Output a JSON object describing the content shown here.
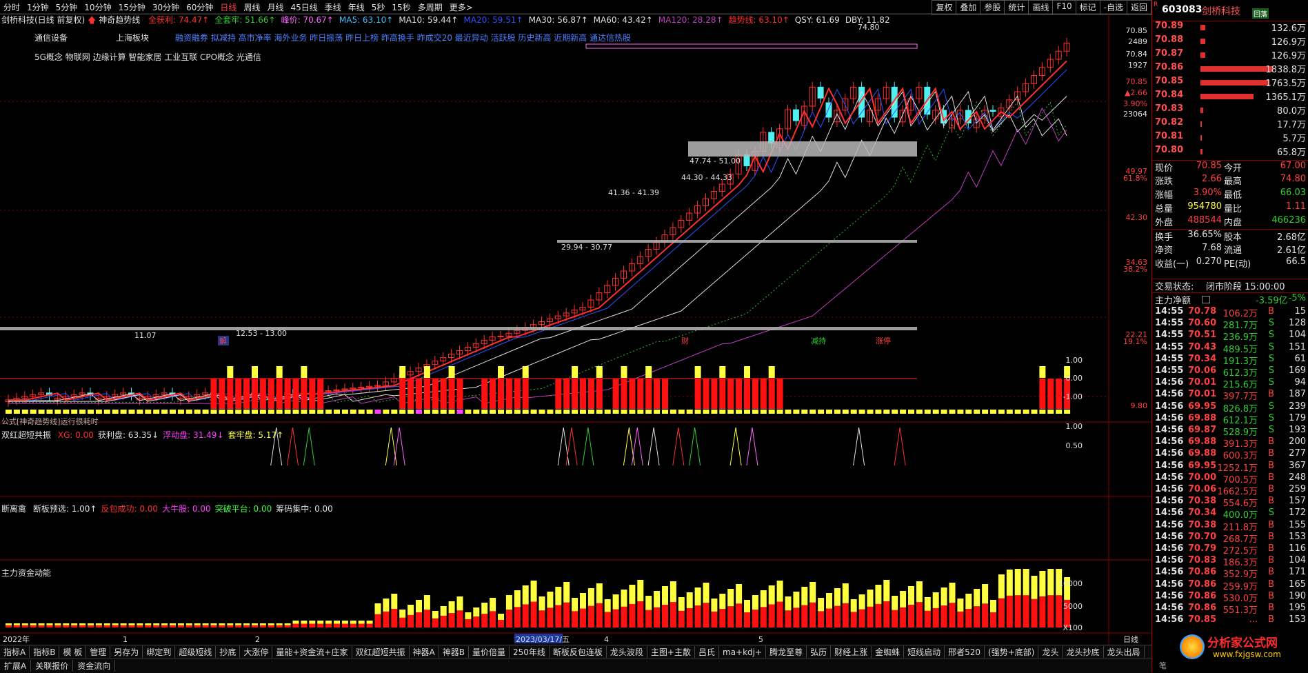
{
  "periods": [
    "分时",
    "1分钟",
    "5分钟",
    "10分钟",
    "15分钟",
    "30分钟",
    "60分钟",
    "日线",
    "周线",
    "月线",
    "45日线",
    "季线",
    "年线",
    "5秒",
    "15秒",
    "多周期",
    "更多>"
  ],
  "active_period": "日线",
  "toolbar": [
    "复权",
    "叠加",
    "参股",
    "统计",
    "画线",
    "F10",
    "标记",
    "-自选",
    "返回"
  ],
  "stock": {
    "title": "剑桥科技(日线 前复权)",
    "indicator_name": "神奇趋势线",
    "code": "603083",
    "name": "剑桥科技",
    "badge": "回落",
    "industry": "通信设备",
    "region": "上海板块",
    "concepts_line1": "融资融券 拟减持 高市净率 海外业务 昨日振荡 昨日上榜 昨高换手 昨成交20 最近异动 活跃股 历史新高 近期新高 通达信热股",
    "concepts_line2": "5G概念 物联网 边缘计算 智能家居 工业互联 CPO概念 光通信"
  },
  "ma_legend": [
    {
      "label": "全获利: 74.47↑",
      "color": "#ff3030"
    },
    {
      "label": "全套牢: 51.66↑",
      "color": "#30d030"
    },
    {
      "label": "峰价: 70.67↑",
      "color": "#ff66ff"
    },
    {
      "label": "MA5: 63.10↑",
      "color": "#40c0ff"
    },
    {
      "label": "MA10: 59.44↑",
      "color": "#e0e0e0"
    },
    {
      "label": "MA20: 59.51↑",
      "color": "#3050ff"
    },
    {
      "label": "MA30: 56.87↑",
      "color": "#e0e0e0"
    },
    {
      "label": "MA60: 43.42↑",
      "color": "#e0e0e0"
    },
    {
      "label": "MA120: 28.28↑",
      "color": "#c040c0"
    },
    {
      "label": "趋势线: 63.10↑",
      "color": "#ff3030"
    },
    {
      "label": "QSY: 61.69",
      "color": "#e0e0e0"
    },
    {
      "label": "DBY: 11.82",
      "color": "#e0e0e0"
    }
  ],
  "price_axis": [
    "70.85",
    "2489",
    "70.84",
    "1927",
    "70.85",
    "▲2.66",
    "3.90%",
    "23064",
    "49.97",
    "61.8%",
    "42.30",
    "34.63",
    "38.2%",
    "22.21",
    "19.1%",
    "9.80"
  ],
  "chart_annotations": {
    "peak_label": "74.80",
    "zone1": "47.74 - 51.00",
    "zone2": "44.30 - 44.33",
    "zone3": "41.36 - 41.39",
    "zone4": "29.94 - 30.77",
    "zone5": "12.53 - 13.00",
    "low_label": "11.07",
    "formula_note": "公式[神奇趋势线]运行很耗时",
    "markers": [
      "解",
      "财",
      "减持",
      "涨停"
    ]
  },
  "sub1": {
    "title": "双红超短共振",
    "items": [
      {
        "label": "XG: 0.00",
        "color": "#ff3030"
      },
      {
        "label": "获利盘: 63.35↓",
        "color": "#e0e0e0"
      },
      {
        "label": "浮动盘: 31.49↓",
        "color": "#ff40ff"
      },
      {
        "label": "套牢盘: 5.17↑",
        "color": "#ffff40"
      }
    ],
    "axis": [
      "1.00",
      "0.00",
      "-1.00"
    ]
  },
  "sub2": {
    "title": "断离禽",
    "items": [
      {
        "label": "断板预选: 1.00↑",
        "color": "#e0e0e0"
      },
      {
        "label": "反包成功: 0.00",
        "color": "#ff3030"
      },
      {
        "label": "大牛股: 0.00",
        "color": "#ff40ff"
      },
      {
        "label": "突破平台: 0.00",
        "color": "#40ff40"
      },
      {
        "label": "筹码集中: 0.00",
        "color": "#e0e0e0"
      }
    ],
    "axis": [
      "1.00",
      "0.50"
    ]
  },
  "sub3": {
    "title": "主力资金动能",
    "axis": [
      "10000",
      "5000",
      "X100"
    ]
  },
  "time_axis": {
    "labels": [
      "2022年",
      "1",
      "2",
      "2023/03/17/五",
      "4",
      "5"
    ],
    "right_label": "日线"
  },
  "tabs": [
    "指标A",
    "指标B",
    "模 板",
    "管理",
    "另存为",
    "绑定到",
    "超级短线",
    "抄底",
    "大涨停",
    "量能+资金流+庄家",
    "双红超短共振",
    "神器A",
    "神器B",
    "量价倍量",
    "250年线",
    "断板反包连板",
    "龙头波段",
    "主图+主散",
    "吕氏",
    "ma+kdj+",
    "腾龙至尊",
    "弘历",
    "财经上涨",
    "金蜘蛛",
    "短线启动",
    "邢者520",
    "(强势+底部)",
    "龙头",
    "龙头抄底",
    "龙头出局"
  ],
  "tabs2": [
    "扩展A",
    "关联报价",
    "资金流向"
  ],
  "order_book": [
    {
      "price": "70.89",
      "vol": "132.6万",
      "bar": 0.06
    },
    {
      "price": "70.88",
      "vol": "126.9万",
      "bar": 0.06
    },
    {
      "price": "70.87",
      "vol": "126.9万",
      "bar": 0.06
    },
    {
      "price": "70.86",
      "vol": "1838.8万",
      "bar": 0.95
    },
    {
      "price": "70.85",
      "vol": "1763.5万",
      "bar": 0.91
    },
    {
      "price": "70.84",
      "vol": "1365.1万",
      "bar": 0.7
    },
    {
      "price": "70.83",
      "vol": "80.0万",
      "bar": 0.04
    },
    {
      "price": "70.82",
      "vol": "17.7万",
      "bar": 0.01
    },
    {
      "price": "70.81",
      "vol": "5.7万",
      "bar": 0.005
    },
    {
      "price": "70.80",
      "vol": "65.8万",
      "bar": 0.03
    }
  ],
  "quote": [
    {
      "l1": "现价",
      "v1": "70.85",
      "c1": "#ff4040",
      "l2": "今开",
      "v2": "67.00",
      "c2": "#ff4040"
    },
    {
      "l1": "涨跌",
      "v1": "2.66",
      "c1": "#ff4040",
      "l2": "最高",
      "v2": "74.80",
      "c2": "#ff4040"
    },
    {
      "l1": "涨幅",
      "v1": "3.90%",
      "c1": "#ff4040",
      "l2": "最低",
      "v2": "66.03",
      "c2": "#30d030"
    },
    {
      "l1": "总量",
      "v1": "954780",
      "c1": "#ffff40",
      "l2": "量比",
      "v2": "1.11",
      "c2": "#ff4040"
    },
    {
      "l1": "外盘",
      "v1": "488544",
      "c1": "#ff4040",
      "l2": "内盘",
      "v2": "466236",
      "c2": "#30d030"
    },
    {
      "l1": "换手",
      "v1": "36.65%",
      "c1": "#e0e0e0",
      "l2": "股本",
      "v2": "2.68亿",
      "c2": "#e0e0e0"
    },
    {
      "l1": "净资",
      "v1": "7.68",
      "c1": "#e0e0e0",
      "l2": "流通",
      "v2": "2.61亿",
      "c2": "#e0e0e0"
    },
    {
      "l1": "收益(一)",
      "v1": "0.270",
      "c1": "#e0e0e0",
      "l2": "PE(动)",
      "v2": "66.5",
      "c2": "#e0e0e0"
    }
  ],
  "trade_status": {
    "label": "交易状态:",
    "value": "闭市阶段 15:00:00"
  },
  "net_flow": {
    "label": "主力净额",
    "value": "-3.59亿",
    "pct": "-5%"
  },
  "ticks": [
    {
      "t": "14:55",
      "p": "70.78",
      "v": "106.2万",
      "s": "B",
      "n": "15"
    },
    {
      "t": "14:55",
      "p": "70.60",
      "v": "281.7万",
      "s": "S",
      "n": "128"
    },
    {
      "t": "14:55",
      "p": "70.51",
      "v": "236.9万",
      "s": "S",
      "n": "104"
    },
    {
      "t": "14:55",
      "p": "70.43",
      "v": "489.5万",
      "s": "S",
      "n": "151"
    },
    {
      "t": "14:55",
      "p": "70.34",
      "v": "191.3万",
      "s": "S",
      "n": "61"
    },
    {
      "t": "14:55",
      "p": "70.06",
      "v": "612.3万",
      "s": "S",
      "n": "169"
    },
    {
      "t": "14:56",
      "p": "70.01",
      "v": "215.6万",
      "s": "S",
      "n": "94"
    },
    {
      "t": "14:56",
      "p": "70.01",
      "v": "397.7万",
      "s": "B",
      "n": "187"
    },
    {
      "t": "14:56",
      "p": "69.95",
      "v": "826.8万",
      "s": "S",
      "n": "239"
    },
    {
      "t": "14:56",
      "p": "69.88",
      "v": "612.1万",
      "s": "S",
      "n": "179"
    },
    {
      "t": "14:56",
      "p": "69.87",
      "v": "528.9万",
      "s": "S",
      "n": "193"
    },
    {
      "t": "14:56",
      "p": "69.88",
      "v": "391.3万",
      "s": "B",
      "n": "200"
    },
    {
      "t": "14:56",
      "p": "69.88",
      "v": "600.3万",
      "s": "B",
      "n": "277"
    },
    {
      "t": "14:56",
      "p": "69.95",
      "v": "1252.1万",
      "s": "B",
      "n": "367"
    },
    {
      "t": "14:56",
      "p": "70.00",
      "v": "700.5万",
      "s": "B",
      "n": "248"
    },
    {
      "t": "14:56",
      "p": "70.06",
      "v": "1662.5万",
      "s": "B",
      "n": "259"
    },
    {
      "t": "14:56",
      "p": "70.38",
      "v": "554.6万",
      "s": "B",
      "n": "157"
    },
    {
      "t": "14:56",
      "p": "70.34",
      "v": "400.0万",
      "s": "S",
      "n": "172"
    },
    {
      "t": "14:56",
      "p": "70.38",
      "v": "211.8万",
      "s": "B",
      "n": "155"
    },
    {
      "t": "14:56",
      "p": "70.70",
      "v": "268.7万",
      "s": "B",
      "n": "153"
    },
    {
      "t": "14:56",
      "p": "70.79",
      "v": "272.5万",
      "s": "B",
      "n": "116"
    },
    {
      "t": "14:56",
      "p": "70.83",
      "v": "186.3万",
      "s": "B",
      "n": "104"
    },
    {
      "t": "14:56",
      "p": "70.86",
      "v": "352.9万",
      "s": "B",
      "n": "171"
    },
    {
      "t": "14:56",
      "p": "70.86",
      "v": "259.9万",
      "s": "B",
      "n": "165"
    },
    {
      "t": "14:56",
      "p": "70.86",
      "v": "530.0万",
      "s": "B",
      "n": "190"
    },
    {
      "t": "14:56",
      "p": "70.86",
      "v": "551.3万",
      "s": "B",
      "n": "195"
    },
    {
      "t": "14:56",
      "p": "70.85",
      "v": "...",
      "s": "B",
      "n": "153"
    }
  ],
  "watermark": {
    "line1": "分析家公式网",
    "line2": "www.fxjgsw.com"
  },
  "footer_char": "笔",
  "colors": {
    "up": "#ff3030",
    "down": "#40e0e0",
    "bg": "#000000",
    "grid": "#8b0000"
  }
}
